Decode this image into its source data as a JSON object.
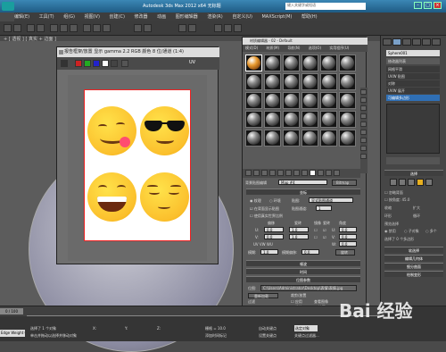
{
  "app": {
    "title": "Autodesk 3ds Max 2012 x64",
    "tab": "无标题",
    "search_placeholder": "键入关键字或短语"
  },
  "menubar": [
    "编辑(E)",
    "工具(T)",
    "组(G)",
    "视图(V)",
    "创建(C)",
    "修改器",
    "动画",
    "图形编辑器",
    "渲染(R)",
    "自定义(U)",
    "MAXScript(M)",
    "帮助(H)"
  ],
  "viewport_label": "+ [ 透视 ] [ 真实 + 边面 ]",
  "material_window": {
    "title": "报告框架/放置 显示 gamma 2.2 RGB 颜色 8 位/通道 (1:4)",
    "uv_label": "UV"
  },
  "material_editor": {
    "title": "材质编辑器 - 02 - Default",
    "menu": [
      "模式(D)",
      "材质(M)",
      "导航(N)",
      "选项(O)",
      "实用程序(U)"
    ],
    "mapname_label": "背景贴图编辑",
    "map_name": "Map #4",
    "map_type": "Bitmap",
    "section_coordinates": "坐标",
    "tex_label": "纹理",
    "env_label": "环境",
    "mapping_label": "贴图:",
    "mapping_value": "显式贴图通道",
    "show_map_back": "在背面显示贴图",
    "map_channel_label": "贴图通道:",
    "map_channel_value": "1",
    "use_real_world": "使用真实世界比例",
    "offset_label": "偏移",
    "tiling_label": "瓷砖",
    "mirror_label": "镜像",
    "tile_label": "瓷砖",
    "angle_label": "角度",
    "u_label": "U:",
    "v_label": "V:",
    "w_label": "W:",
    "u_offset": "0.0",
    "v_offset": "0.0",
    "u_tiling": "1.0",
    "v_tiling": "1.0",
    "u_angle": "0.0",
    "v_angle": "0.0",
    "w_angle": "0.0",
    "uv_vw_wu": "UV  VW  WU",
    "blur_label": "模糊:",
    "blur_value": "1.0",
    "blur_offset_label": "模糊偏移:",
    "blur_offset_value": "0.0",
    "rotate_button": "旋转",
    "section_noise": "噪波",
    "section_time": "时间",
    "section_bitmap_params": "位图参数",
    "bitmap_label": "位图:",
    "bitmap_path": "C:\\Users\\Administrator\\Desktop\\表情\\表情.jpg",
    "reload_button": "重新加载",
    "filter_label": "过滤",
    "filter_options": [
      "四棱锥",
      "总面积",
      "无"
    ],
    "crop_label": "裁剪/放置",
    "apply_label": "应用",
    "view_image": "查看图像",
    "crop_option": "裁剪",
    "place_option": "放置",
    "mono_label": "单通道输出:",
    "u_crop": "0.0",
    "w_crop": "1.0"
  },
  "command_panel": {
    "object_name": "Sphere001",
    "modifier_list": "修改器列表",
    "modifiers": [
      "网格平滑",
      "UVW 贴图",
      "对称",
      "UVW 展开",
      "可编辑多边形"
    ],
    "active_modifier": "可编辑多边形",
    "selection_label": "选择",
    "soft_selection": "软选择",
    "edit_geometry": "编辑几何体",
    "subdivision": "细分曲面",
    "paint_deform": "绘制变形",
    "ignore_backface": "忽略背面",
    "by_angle": "按角度:",
    "angle_value": "45.0",
    "shrink": "收缩",
    "grow": "扩大",
    "ring": "环形",
    "loop": "循环",
    "preview": "预览选择",
    "off": "禁用",
    "subobj": "子对象",
    "multi": "多个",
    "selected_count": "选择了 0 个多边形"
  },
  "status_bar": {
    "frame": "0 / 100",
    "selected": "选择了 1 个对象",
    "hint": "单击并拖动以选择并移动对象",
    "x_label": "X:",
    "y_label": "Y:",
    "z_label": "Z:",
    "grid": "栅格 = 10.0",
    "autokey": "自动关键点",
    "selected_obj": "选定对象",
    "setkey": "设置关键点",
    "keyfilter": "关键点过滤器...",
    "add_time_tag": "添加时间标记",
    "script_input": "Edge Weight 0.0"
  },
  "watermark": "Bai 经验",
  "colors": {
    "title_bar": "#2e76a3",
    "active_modifier": "#2f6fb5",
    "bitmap_border": "#e22222"
  }
}
